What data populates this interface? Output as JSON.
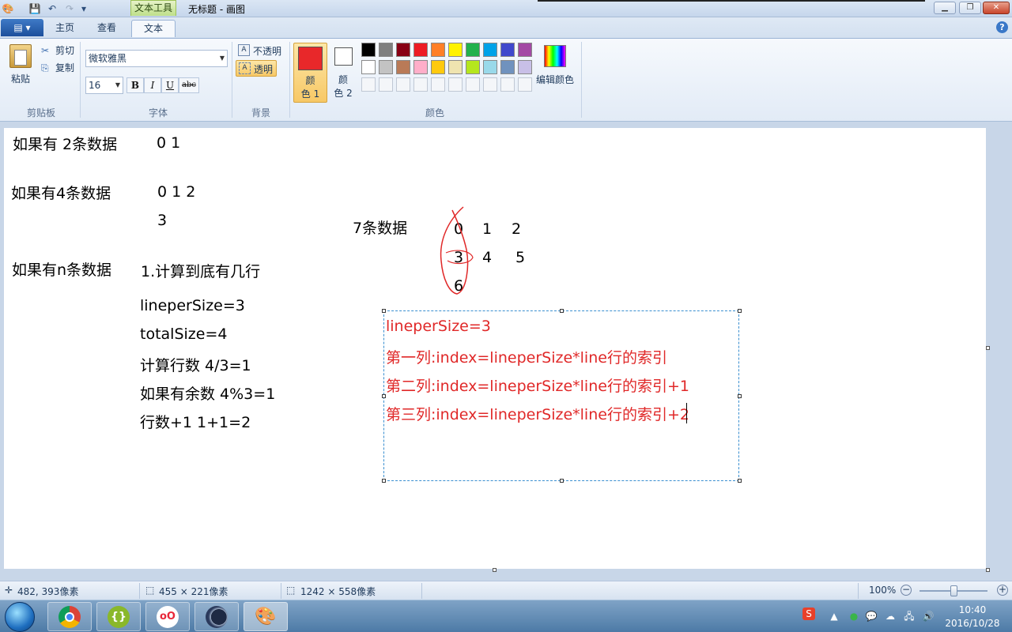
{
  "app": {
    "title": "无标题 - 画图",
    "context_tab": "文本工具"
  },
  "tabs": {
    "file": "▤ ▾",
    "home": "主页",
    "view": "查看",
    "text": "文本"
  },
  "ribbon": {
    "clipboard": {
      "paste": "粘贴",
      "cut": "剪切",
      "copy": "复制",
      "group": "剪贴板"
    },
    "font": {
      "family": "微软雅黑",
      "size": "16",
      "bold": "B",
      "italic": "I",
      "underline": "U",
      "strike": "abc",
      "group": "字体"
    },
    "background": {
      "opaque": "不透明",
      "transparent": "透明",
      "group": "背景"
    },
    "colors": {
      "color1_line1": "颜",
      "color1_line2": "色 1",
      "color2_line1": "颜",
      "color2_line2": "色 2",
      "edit": "编辑颜色",
      "group": "颜色",
      "color1_value": "#e8282a",
      "color2_value": "#ffffff",
      "palette_row1": [
        "#000000",
        "#7f7f7f",
        "#880015",
        "#ed1c24",
        "#ff7f27",
        "#fff200",
        "#22b14c",
        "#00a2e8",
        "#3f48cc",
        "#a349a4"
      ],
      "palette_row2": [
        "#ffffff",
        "#c3c3c3",
        "#b97a57",
        "#ffaec9",
        "#ffc90e",
        "#efe4b0",
        "#b5e61d",
        "#99d9ea",
        "#7092be",
        "#c8bfe7"
      ]
    }
  },
  "canvas": {
    "notes": [
      "如果有 2条数据",
      "0   1",
      "如果有4条数据",
      "0  1   2",
      "3",
      "如果有n条数据",
      "1.计算到底有几行",
      "lineperSize=3",
      "totalSize=4",
      "计算行数 4/3=1",
      "如果有余数 4%3=1",
      "行数+1   1+1=2",
      "7条数据",
      "0",
      "1",
      "2",
      "3",
      "4",
      "5",
      "6"
    ],
    "textbox_lines": [
      "lineperSize=3",
      "第一列:index=lineperSize*line行的索引",
      "第二列:index=lineperSize*line行的索引+1",
      "第三列:index=lineperSize*line行的索引+2"
    ]
  },
  "statusbar": {
    "cursor": "482, 393像素",
    "selection": "455 × 221像素",
    "canvas_size": "1242 × 558像素",
    "zoom": "100%"
  },
  "taskbar": {
    "time": "10:40",
    "date": "2016/10/28"
  }
}
